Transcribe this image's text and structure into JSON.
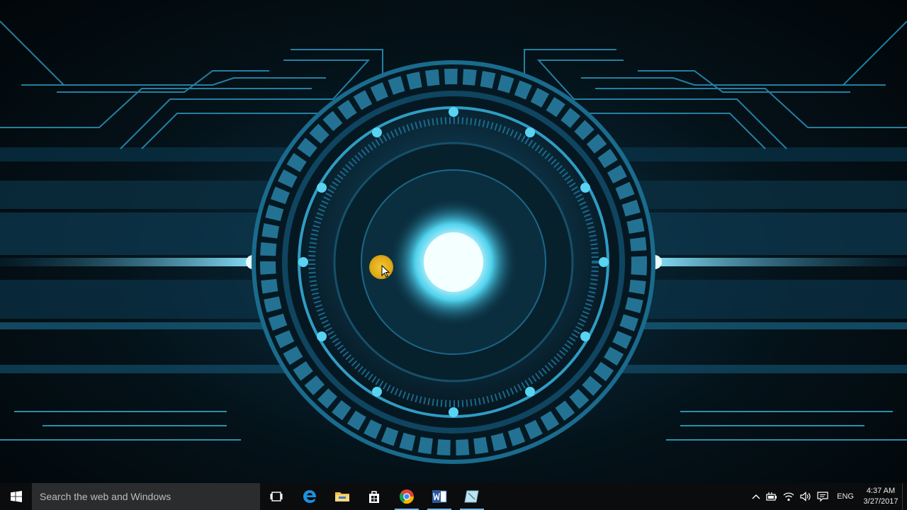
{
  "taskbar": {
    "search_placeholder": "Search the web and Windows",
    "pinned_apps": [
      {
        "name": "Task View",
        "icon": "task-view-icon"
      },
      {
        "name": "Microsoft Edge",
        "icon": "edge-icon"
      },
      {
        "name": "File Explorer",
        "icon": "folder-icon"
      },
      {
        "name": "Store",
        "icon": "store-icon"
      },
      {
        "name": "Google Chrome",
        "icon": "chrome-icon",
        "running": true
      },
      {
        "name": "Microsoft Word",
        "icon": "word-icon",
        "running": true
      },
      {
        "name": "Snipping Tool",
        "icon": "snipping-tool-icon",
        "running": true
      }
    ]
  },
  "tray": {
    "language": "ENG",
    "time": "4:37 AM",
    "date": "3/27/2017",
    "icons": [
      "chevron-up-icon",
      "battery-icon",
      "wifi-icon",
      "volume-icon",
      "action-center-icon"
    ]
  },
  "colors": {
    "wallpaper_glow": "#bff6ff",
    "wallpaper_accent": "#1fa7d6",
    "taskbar_bg": "#0b0c0e",
    "search_bg": "#2b2c2e",
    "cursor_highlight": "#e8b21c"
  }
}
